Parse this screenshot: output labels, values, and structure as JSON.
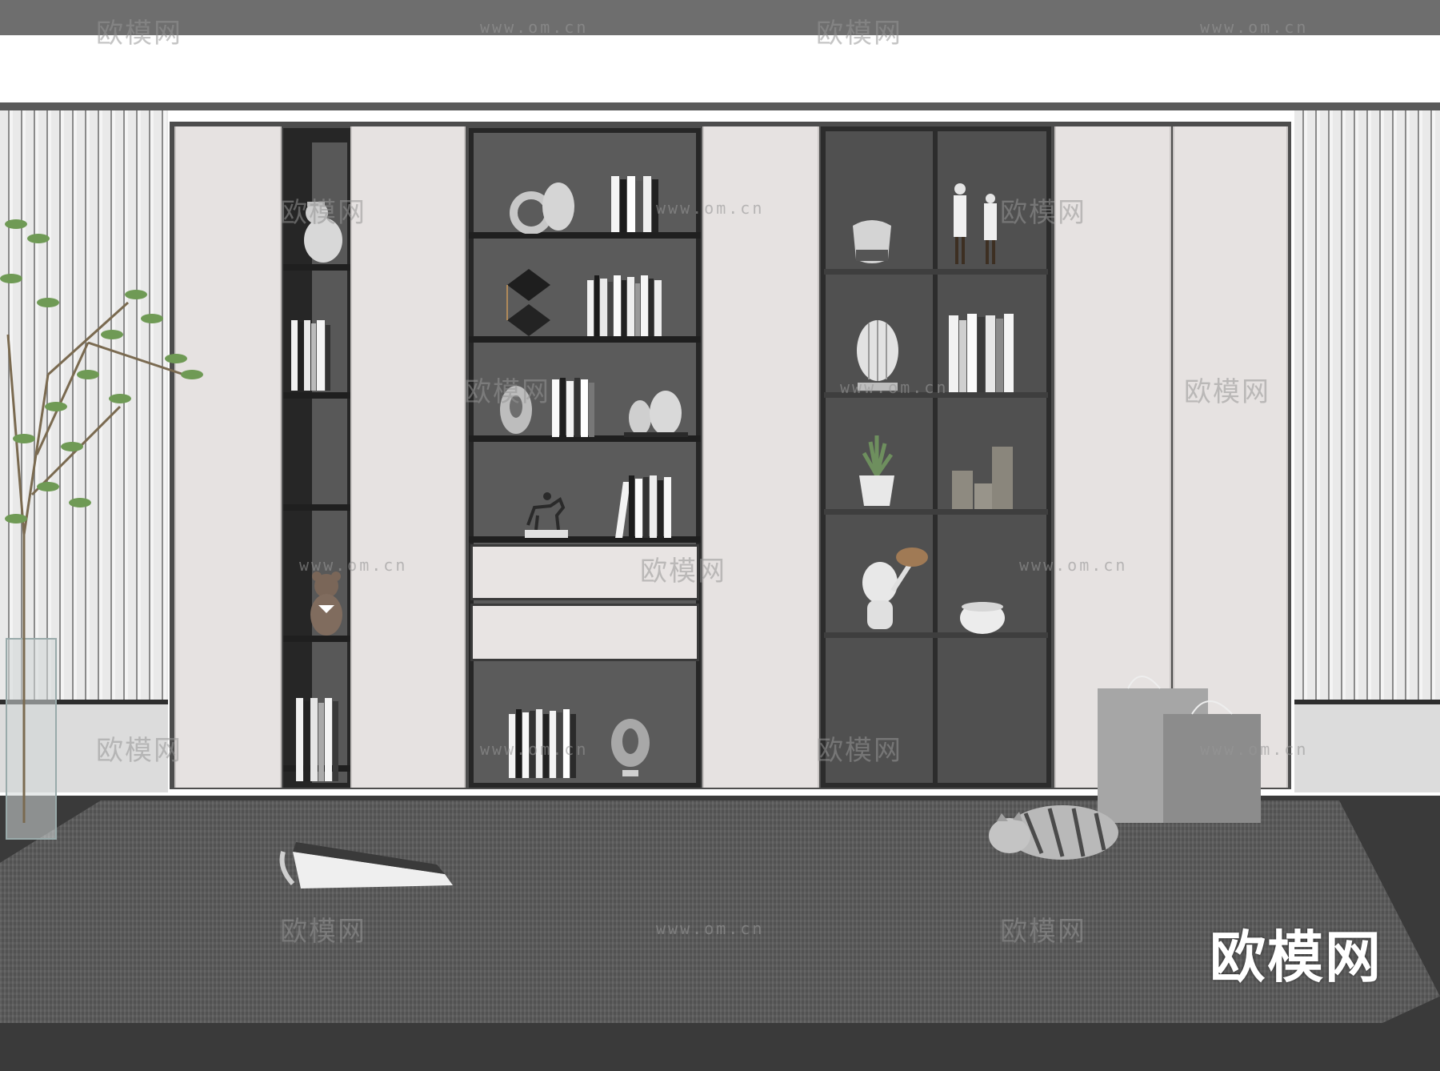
{
  "scene": {
    "description_tags": [
      "bookcase-wall",
      "fluted-wall-panel",
      "plant",
      "rug",
      "cat",
      "shopping-bags",
      "magazine"
    ],
    "colors": {
      "cabinet_frame": "#4d4d4d",
      "door_panel": "#e6e2e1",
      "shelf_interior": "#5b5b5b",
      "glass_frame": "#2c2c2c",
      "rug": "#5a5a5a",
      "floor": "#3a3a3a"
    }
  },
  "watermark": {
    "logo_text": "欧模网",
    "url_text": "www.om.cn",
    "brand_text": "欧模网"
  }
}
